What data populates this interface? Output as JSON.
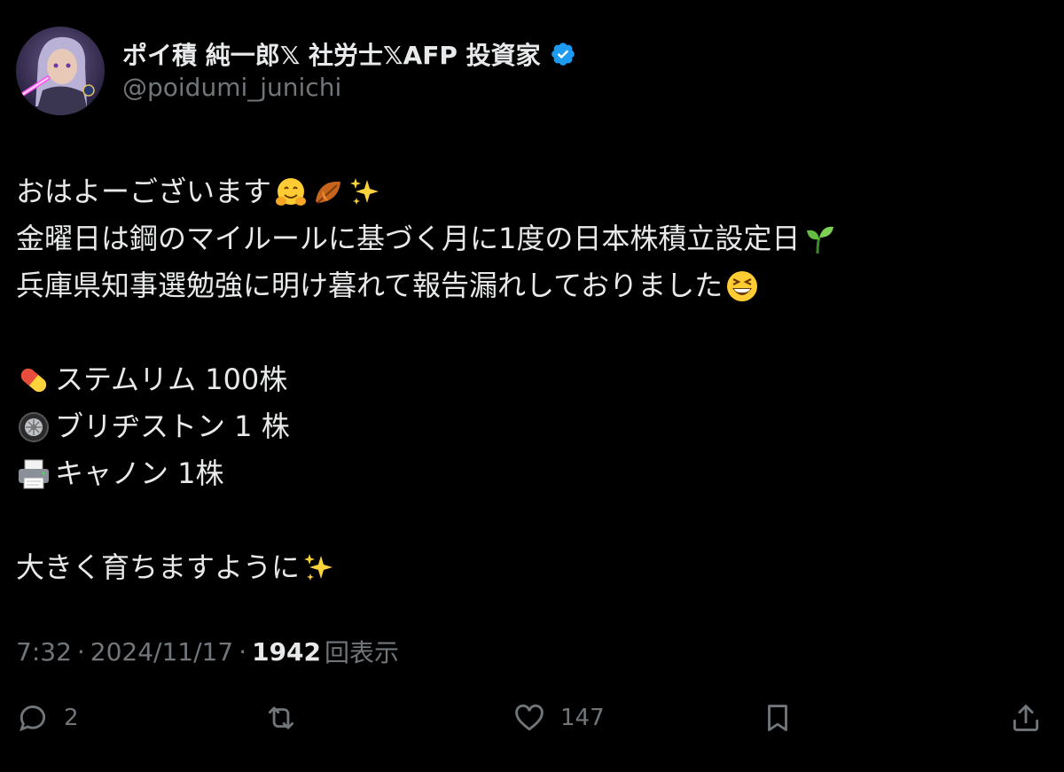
{
  "author": {
    "display_name": "ポイ積 純一郎𝕏 社労士𝕏AFP 投資家",
    "handle": "@poidumi_junichi",
    "verified": true,
    "verified_color": "#1d9bf0"
  },
  "tweet": {
    "lines": [
      {
        "text": "おはよーございます",
        "emoji_after": [
          "hugging-face",
          "fallen-leaf",
          "sparkles"
        ]
      },
      {
        "text": "金曜日は鋼のマイルールに基づく月に1度の日本株積立設定日",
        "emoji_after": [
          "seedling"
        ]
      },
      {
        "text": "兵庫県知事選勉強に明け暮れて報告漏れしておりました",
        "emoji_after": [
          "grinning-squinting-face"
        ]
      },
      {
        "text": ""
      },
      {
        "text": "ステムリム 100株",
        "emoji_before": "pill"
      },
      {
        "text": "ブリヂストン 1 株",
        "emoji_before": "wheel"
      },
      {
        "text": "キャノン 1株",
        "emoji_before": "printer"
      },
      {
        "text": ""
      },
      {
        "text": "大きく育ちますように",
        "emoji_after": [
          "sparkles"
        ]
      }
    ]
  },
  "meta": {
    "time": "7:32",
    "date": "2024/11/17",
    "views": "1942",
    "views_label": "回表示"
  },
  "actions": {
    "reply_count": "2",
    "like_count": "147"
  },
  "colors": {
    "background": "#000000",
    "text": "#e7e9ea",
    "muted": "#71767b"
  }
}
